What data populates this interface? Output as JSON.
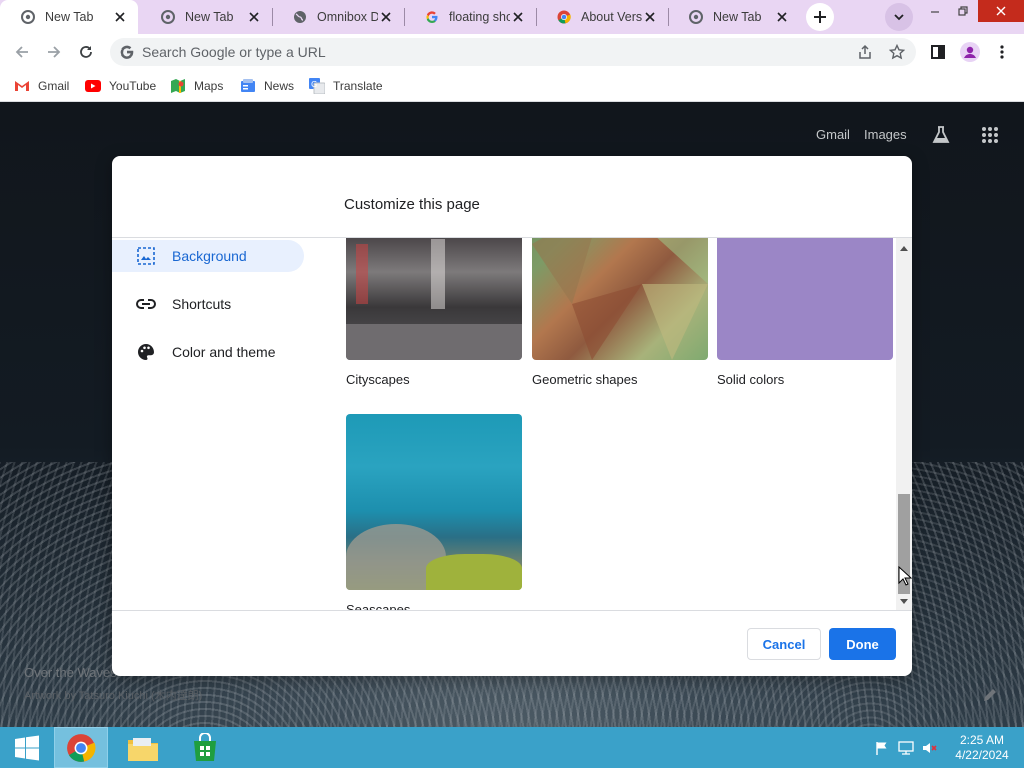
{
  "browser": {
    "tabs": [
      {
        "title": "New Tab",
        "active": true,
        "favicon": "chrome-page-icon"
      },
      {
        "title": "New Tab",
        "active": false,
        "favicon": "chrome-page-icon"
      },
      {
        "title": "Omnibox De",
        "active": false,
        "favicon": "globe-icon"
      },
      {
        "title": "floating shop",
        "active": false,
        "favicon": "google-g-icon"
      },
      {
        "title": "About Versic",
        "active": false,
        "favicon": "chrome-logo-icon"
      },
      {
        "title": "New Tab",
        "active": false,
        "favicon": "chrome-page-icon"
      }
    ],
    "omnibox_placeholder": "Search Google or type a URL",
    "bookmarks": [
      {
        "label": "Gmail",
        "icon": "gmail-icon"
      },
      {
        "label": "YouTube",
        "icon": "youtube-icon"
      },
      {
        "label": "Maps",
        "icon": "maps-icon"
      },
      {
        "label": "News",
        "icon": "news-icon"
      },
      {
        "label": "Translate",
        "icon": "translate-icon"
      }
    ]
  },
  "ntp": {
    "gmail_link": "Gmail",
    "images_link": "Images",
    "attribution_title": "Over the Waves",
    "attribution_author": "Artwork by Tatsuro Kiuchi (木内達朗)"
  },
  "dialog": {
    "title": "Customize this page",
    "menu": [
      {
        "label": "Background",
        "icon": "image-icon",
        "selected": true
      },
      {
        "label": "Shortcuts",
        "icon": "link-icon",
        "selected": false
      },
      {
        "label": "Color and theme",
        "icon": "palette-icon",
        "selected": false
      }
    ],
    "tiles": [
      {
        "label": "Cityscapes"
      },
      {
        "label": "Geometric shapes"
      },
      {
        "label": "Solid colors"
      },
      {
        "label": "Seascapes"
      }
    ],
    "cancel_label": "Cancel",
    "done_label": "Done"
  },
  "taskbar": {
    "time": "2:25 AM",
    "date": "4/22/2024"
  },
  "colors": {
    "accent": "#1a73e8",
    "tabstrip": "#e9d6f3",
    "taskbar": "#3aa1c9"
  }
}
